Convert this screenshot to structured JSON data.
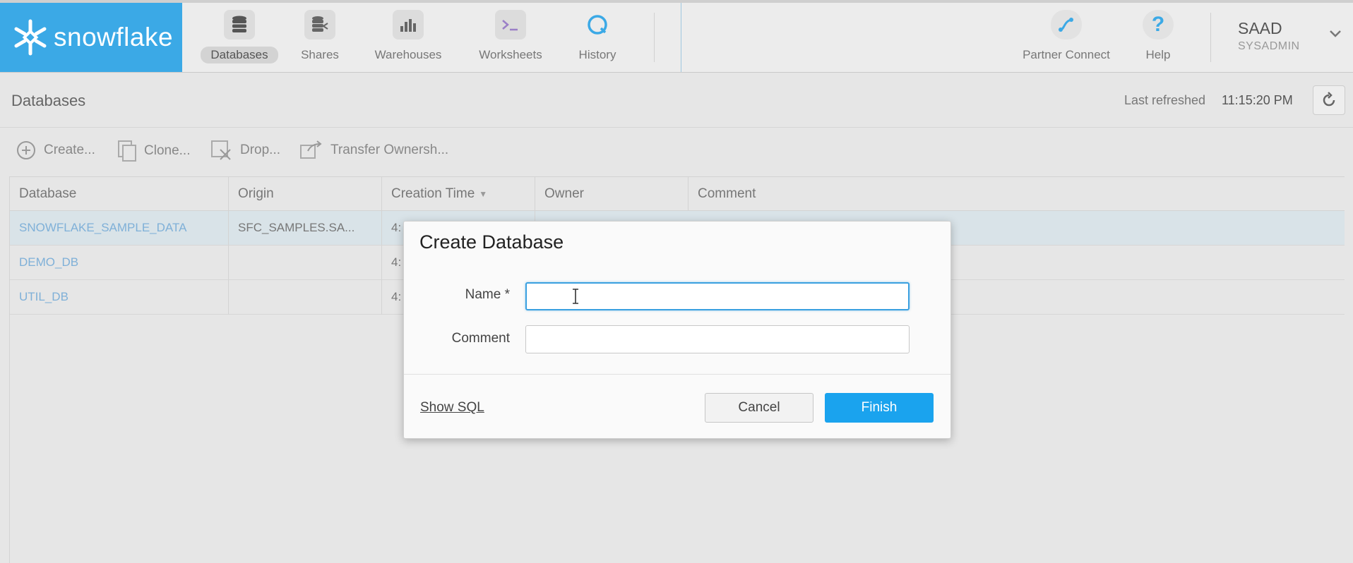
{
  "brand": {
    "name": "snowflake",
    "color": "#3ba9e6"
  },
  "nav": {
    "items": [
      {
        "label": "Databases",
        "icon": "database-icon",
        "active": true
      },
      {
        "label": "Shares",
        "icon": "share-icon"
      },
      {
        "label": "Warehouses",
        "icon": "warehouse-icon"
      },
      {
        "label": "Worksheets",
        "icon": "worksheet-icon"
      },
      {
        "label": "History",
        "icon": "history-icon"
      }
    ],
    "partner_connect": "Partner Connect",
    "help": "Help",
    "help_glyph": "?",
    "user": {
      "name": "SAAD",
      "role": "SYSADMIN"
    }
  },
  "page": {
    "title": "Databases",
    "last_refreshed_label": "Last refreshed",
    "last_refreshed_time": "11:15:20 PM"
  },
  "toolbar": {
    "create": "Create...",
    "clone": "Clone...",
    "drop": "Drop...",
    "transfer": "Transfer Ownersh..."
  },
  "table": {
    "columns": [
      "Database",
      "Origin",
      "Creation Time",
      "Owner",
      "Comment"
    ],
    "sort_indicator": "▼",
    "rows": [
      {
        "database": "SNOWFLAKE_SAMPLE_DATA",
        "origin": "SFC_SAMPLES.SA...",
        "creation": "4:",
        "selected": true
      },
      {
        "database": "DEMO_DB",
        "origin": "",
        "creation": "4:"
      },
      {
        "database": "UTIL_DB",
        "origin": "",
        "creation": "4:"
      }
    ]
  },
  "dialog": {
    "title": "Create Database",
    "name_label": "Name *",
    "name_value": "",
    "comment_label": "Comment",
    "comment_value": "",
    "show_sql": "Show SQL",
    "cancel": "Cancel",
    "finish": "Finish",
    "accent": "#1aa3ee"
  }
}
